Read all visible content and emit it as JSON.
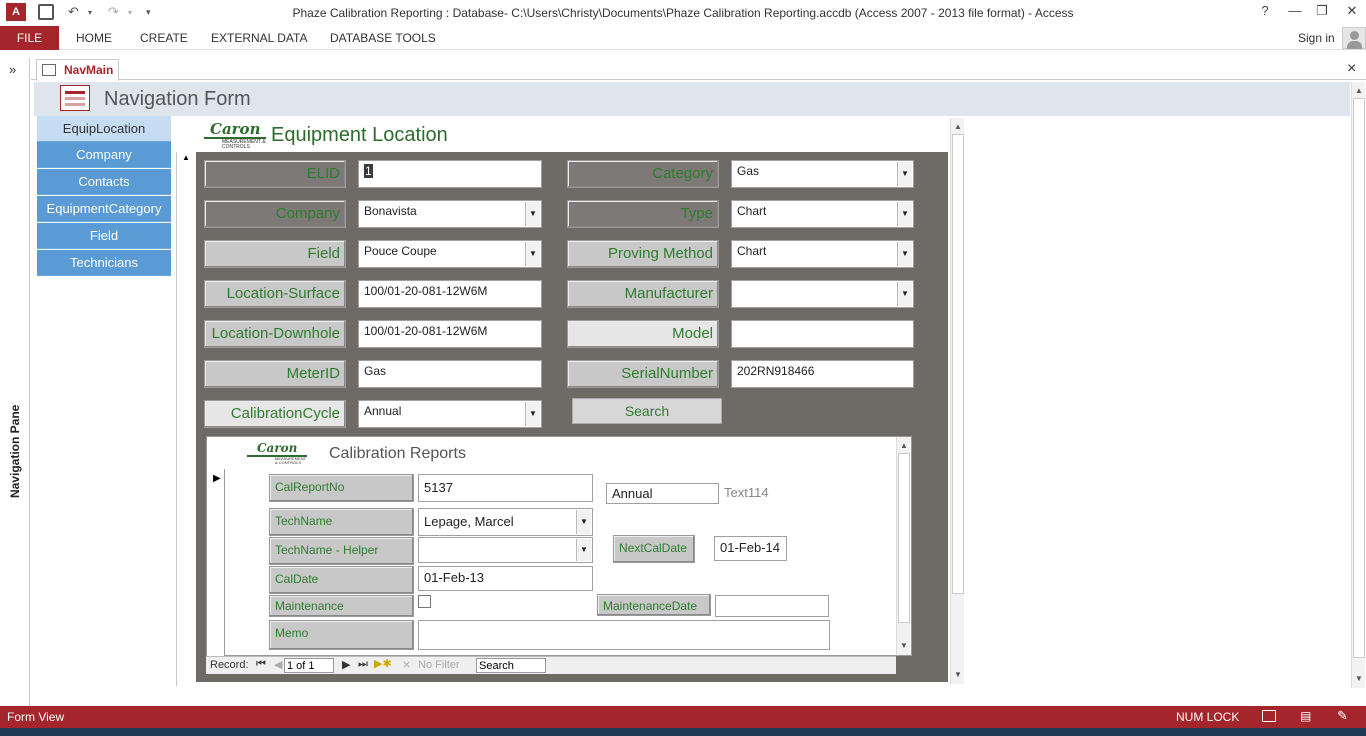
{
  "window": {
    "title": "Phaze Calibration Reporting : Database- C:\\Users\\Christy\\Documents\\Phaze Calibration Reporting.accdb (Access 2007 - 2013 file format) - Access",
    "help": "?",
    "sign_in": "Sign in"
  },
  "ribbon": {
    "file": "FILE",
    "tabs": [
      "HOME",
      "CREATE",
      "EXTERNAL DATA",
      "DATABASE TOOLS"
    ]
  },
  "nav_pane": {
    "label": "Navigation Pane",
    "expand": "»"
  },
  "doc_tab": {
    "label": "NavMain",
    "close": "×"
  },
  "nav_form": {
    "title": "Navigation Form",
    "buttons": [
      "EquipLocation",
      "Company",
      "Contacts",
      "EquipmentCategory",
      "Field",
      "Technicians"
    ],
    "selected": "EquipLocation"
  },
  "equipment_form": {
    "title": "Equipment Location",
    "logo_text": "Caron",
    "logo_sub": "MEASUREMENT & CONTROLS",
    "left": [
      {
        "label": "ELID",
        "value": "1",
        "dropdown": false
      },
      {
        "label": "Company",
        "value": "Bonavista",
        "dropdown": true
      },
      {
        "label": "Field",
        "value": "Pouce Coupe",
        "dropdown": true
      },
      {
        "label": "Location-Surface",
        "value": "100/01-20-081-12W6M",
        "dropdown": false
      },
      {
        "label": "Location-Downhole",
        "value": "100/01-20-081-12W6M",
        "dropdown": false
      },
      {
        "label": "MeterID",
        "value": "Gas",
        "dropdown": false
      },
      {
        "label": "CalibrationCycle",
        "value": "Annual",
        "dropdown": true
      }
    ],
    "right": [
      {
        "label": "Category",
        "value": "Gas",
        "dropdown": true
      },
      {
        "label": "Type",
        "value": "Chart",
        "dropdown": true
      },
      {
        "label": "Proving  Method",
        "value": "Chart",
        "dropdown": true
      },
      {
        "label": "Manufacturer",
        "value": "",
        "dropdown": true
      },
      {
        "label": "Model",
        "value": "",
        "dropdown": false
      },
      {
        "label": "SerialNumber",
        "value": "202RN918466",
        "dropdown": false
      }
    ],
    "search_button": "Search"
  },
  "calibration_reports": {
    "title": "Calibration Reports",
    "labels": {
      "cal_report_no": "CalReportNo",
      "tech_name": "TechName",
      "tech_helper": "TechName  - Helper",
      "cal_date": "CalDate",
      "maintenance": "Maintenance",
      "memo": "Memo",
      "next_cal_date": "NextCalDate",
      "maintenance_date": "MaintenanceDate"
    },
    "values": {
      "cal_report_no": "5137",
      "tech_name": "Lepage, Marcel",
      "tech_helper": "",
      "cal_date": "01-Feb-13",
      "maintenance_checked": false,
      "memo": "",
      "cycle": "Annual",
      "text114": "Text114",
      "next_cal_date": "01-Feb-14",
      "maintenance_date": ""
    },
    "record_bar": {
      "record_label": "Record:",
      "position": "1 of 1",
      "filter": "No Filter",
      "search": "Search"
    }
  },
  "status": {
    "view": "Form View",
    "num_lock": "NUM LOCK"
  },
  "colors": {
    "access_red": "#a4262c",
    "nav_blue": "#5a9bd5",
    "label_green": "#2e7d2e",
    "form_gray": "#6e6a66"
  }
}
